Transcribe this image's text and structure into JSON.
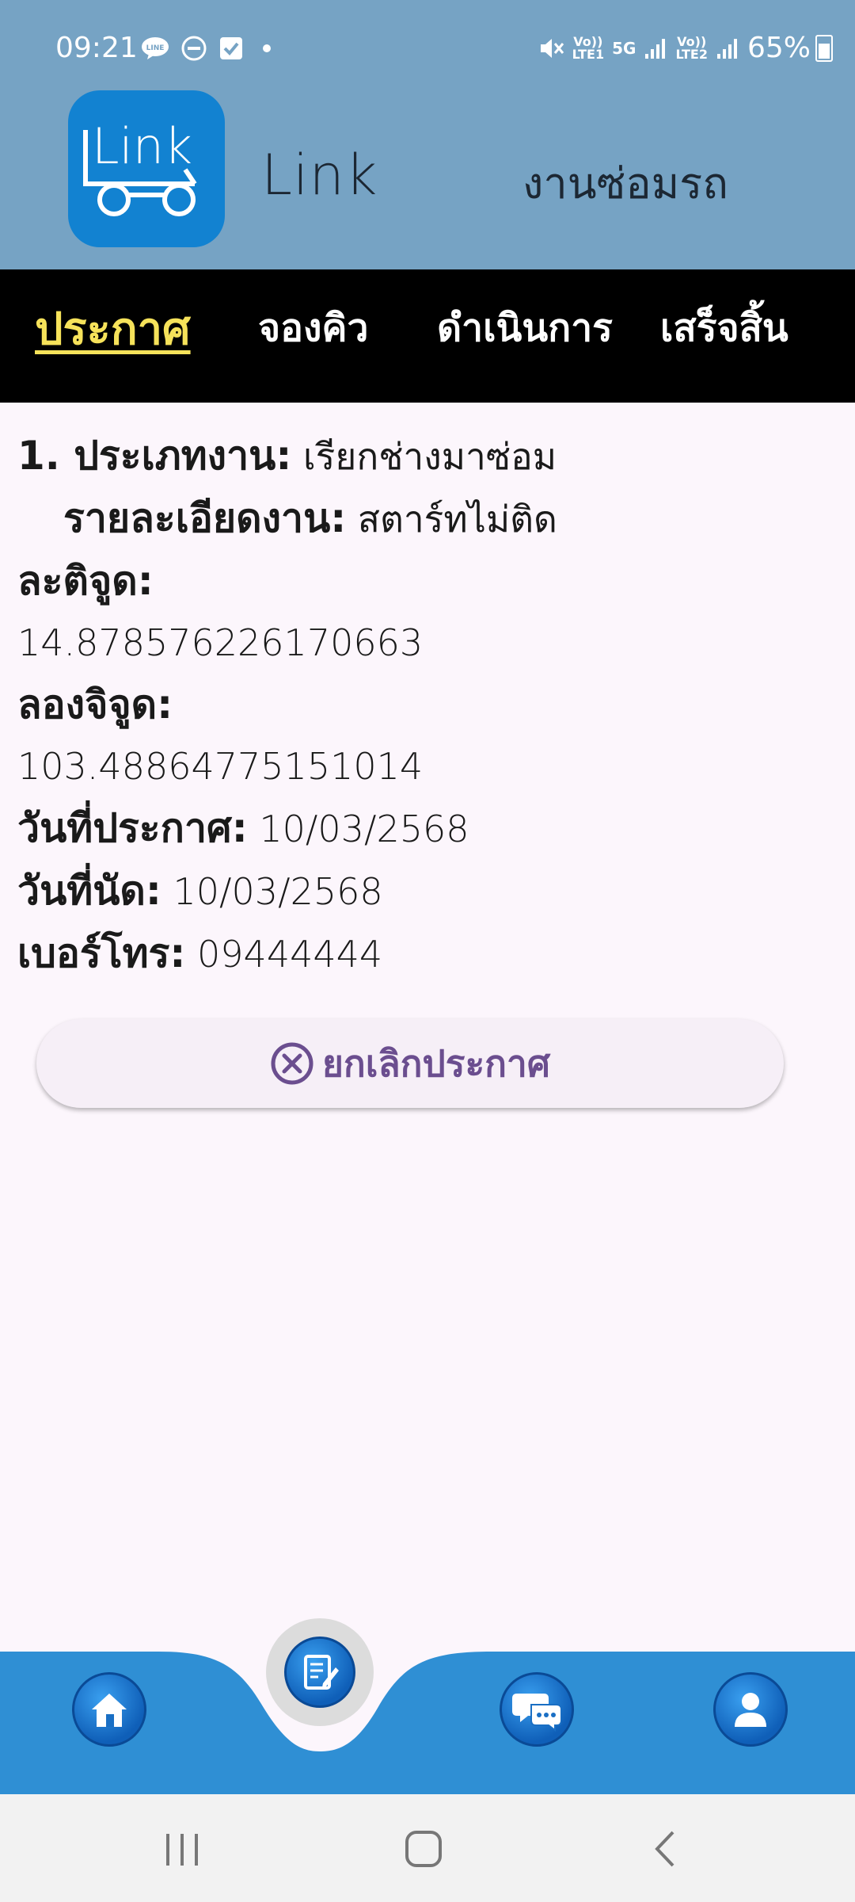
{
  "status_bar": {
    "time": "09:21",
    "left_icons": [
      "line-icon",
      "dnd-icon",
      "check-icon",
      "dot-icon"
    ],
    "mute_icon": "mute-icon",
    "sim1_label": "Vo))\nLTE1",
    "net_label": "5G",
    "sim2_label": "Vo))\nLTE2",
    "battery": "65%"
  },
  "header": {
    "logo_text": "Link",
    "app_name": "Link",
    "section_title": "งานซ่อมรถ"
  },
  "tabs": [
    {
      "label": "ประกาศ",
      "active": true
    },
    {
      "label": "จองคิว",
      "active": false
    },
    {
      "label": "ดำเนินการ",
      "active": false
    },
    {
      "label": "เสร็จสิ้น",
      "active": false
    }
  ],
  "details": {
    "job_type_label": "1. ประเภทงาน:",
    "job_type_value": "เรียกช่างมาซ่อม",
    "job_detail_label": "รายละเอียดงาน:",
    "job_detail_value": "สตาร์ทไม่ติด",
    "latitude_label": "ละติจูด:",
    "latitude_value": "14.878576226170663",
    "longitude_label": "ลองจิจูด:",
    "longitude_value": "103.48864775151014",
    "announce_date_label": "วันที่ประกาศ:",
    "announce_date_value": "10/03/2568",
    "appointment_date_label": "วันที่นัด:",
    "appointment_date_value": "10/03/2568",
    "phone_label": "เบอร์โทร:",
    "phone_value": "09444444"
  },
  "cancel_button": {
    "label": "ยกเลิกประกาศ",
    "icon": "cancel-circle-icon"
  },
  "bottom_nav": {
    "items": [
      "home-icon",
      "edit-document-icon",
      "chat-icon",
      "profile-icon"
    ],
    "bar_color": "#2f8fd4"
  },
  "colors": {
    "header_bg": "#76a3c4",
    "tab_bg": "#000000",
    "active_tab": "#f6e25a",
    "content_bg": "#fcf6fc",
    "button_text": "#6b4e8f"
  }
}
